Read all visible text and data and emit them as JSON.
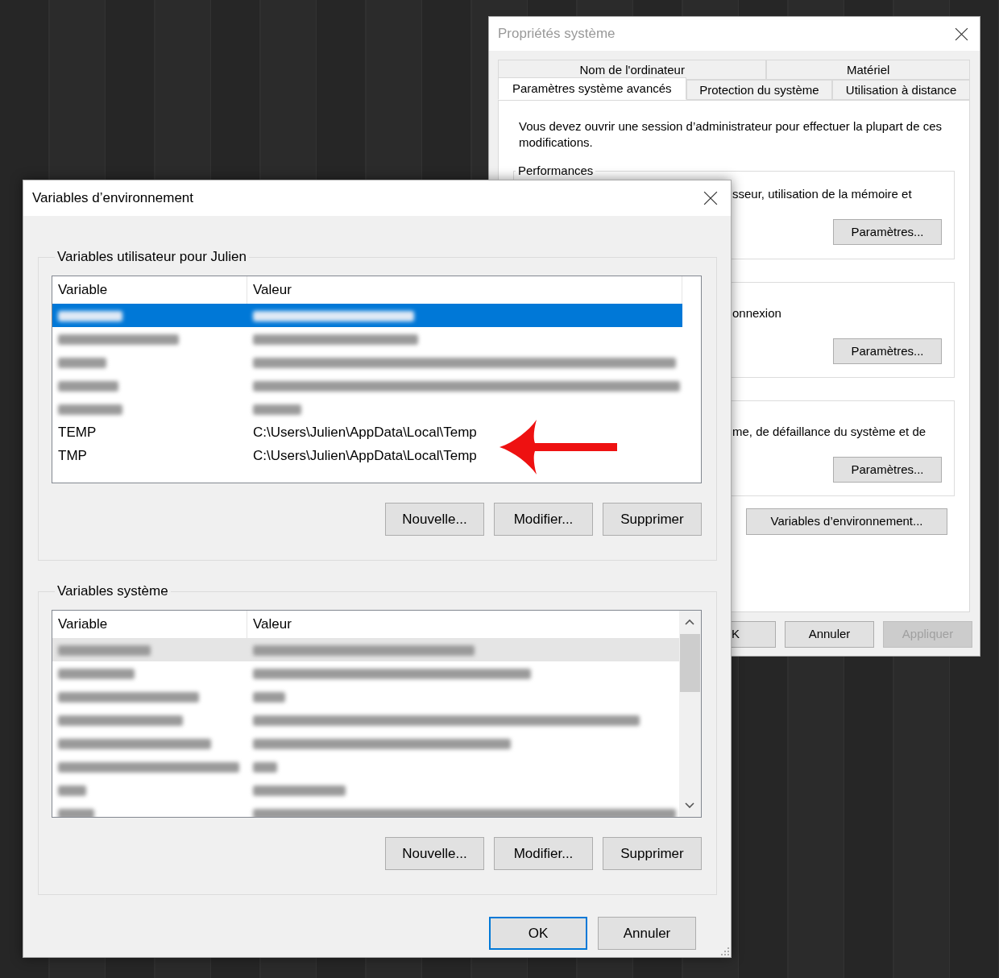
{
  "system_properties": {
    "title": "Propriétés système",
    "tabs_row1": [
      {
        "label": "Nom de l'ordinateur",
        "selected": false
      },
      {
        "label": "Matériel",
        "selected": false
      }
    ],
    "tabs_row2": [
      {
        "label": "Paramètres système avancés",
        "selected": true
      },
      {
        "label": "Protection du système",
        "selected": false
      },
      {
        "label": "Utilisation à distance",
        "selected": false
      }
    ],
    "notice": "Vous devez ouvrir une session d’administrateur pour effectuer la plupart de ces modifications.",
    "groups": [
      {
        "legend": "Performances",
        "text": "sseur, utilisation de la mémoire et",
        "button": "Paramètres..."
      },
      {
        "text": "onnexion",
        "button": "Paramètres..."
      },
      {
        "text": "me, de défaillance du système et de",
        "button": "Paramètres..."
      }
    ],
    "env_button": "Variables d’environnement...",
    "buttons": [
      {
        "label": "K",
        "disabled": false
      },
      {
        "label": "Annuler",
        "disabled": false
      },
      {
        "label": "Appliquer",
        "disabled": true
      }
    ]
  },
  "environment_variables": {
    "title": "Variables d’environnement",
    "sections": [
      {
        "legend": "Variables utilisateur pour Julien",
        "columns": [
          "Variable",
          "Valeur"
        ],
        "scrollbar": false,
        "rows": [
          {
            "kind": "blurred",
            "selected": true,
            "highlighted": false
          },
          {
            "kind": "blurred",
            "selected": false,
            "highlighted": false
          },
          {
            "kind": "blurred",
            "selected": false,
            "highlighted": false
          },
          {
            "kind": "blurred",
            "selected": false,
            "highlighted": false
          },
          {
            "kind": "blurred",
            "selected": false,
            "highlighted": false
          },
          {
            "kind": "text",
            "variable": "TEMP",
            "value": "C:\\Users\\Julien\\AppData\\Local\\Temp",
            "selected": false,
            "highlighted": false
          },
          {
            "kind": "text",
            "variable": "TMP",
            "value": "C:\\Users\\Julien\\AppData\\Local\\Temp",
            "selected": false,
            "highlighted": false
          }
        ],
        "buttons": [
          "Nouvelle...",
          "Modifier...",
          "Supprimer"
        ]
      },
      {
        "legend": "Variables système",
        "columns": [
          "Variable",
          "Valeur"
        ],
        "scrollbar": true,
        "rows": [
          {
            "kind": "blurred",
            "selected": false,
            "highlighted": true
          },
          {
            "kind": "blurred",
            "selected": false,
            "highlighted": false
          },
          {
            "kind": "blurred",
            "selected": false,
            "highlighted": false
          },
          {
            "kind": "blurred",
            "selected": false,
            "highlighted": false
          },
          {
            "kind": "blurred",
            "selected": false,
            "highlighted": false
          },
          {
            "kind": "blurred",
            "selected": false,
            "highlighted": false
          },
          {
            "kind": "blurred",
            "selected": false,
            "highlighted": false
          },
          {
            "kind": "blurred",
            "selected": false,
            "highlighted": false
          }
        ],
        "buttons": [
          "Nouvelle...",
          "Modifier...",
          "Supprimer"
        ]
      }
    ],
    "footer_buttons": [
      {
        "label": "OK",
        "default": true
      },
      {
        "label": "Annuler",
        "default": false
      }
    ]
  }
}
